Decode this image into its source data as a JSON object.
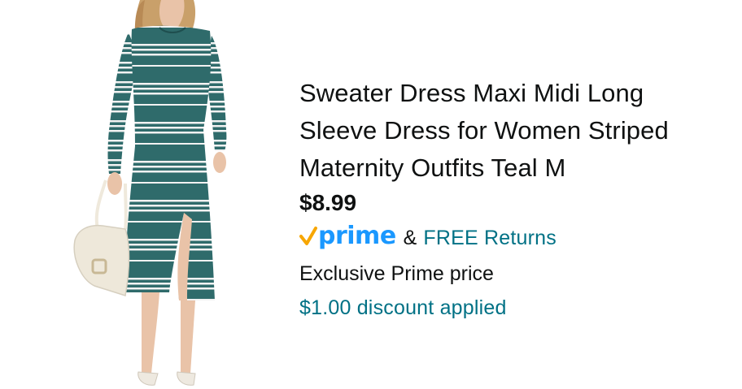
{
  "product": {
    "image_icon": "product-photo-striped-dress",
    "title": "Sweater Dress Maxi Midi Long Sleeve Dress for Women Striped Maternity Outfits Teal M",
    "price": "$8.99",
    "prime": {
      "logo_text": "prime",
      "check_icon": "prime-check-icon",
      "ampersand": "&",
      "returns_label": "FREE Returns"
    },
    "exclusive_label": "Exclusive Prime price",
    "discount_label": "$1.00 discount applied"
  },
  "colors": {
    "prime_blue": "#1a98ff",
    "prime_check": "#f7a600",
    "link_teal": "#007185",
    "dress_teal": "#2f6b6b",
    "text": "#0f1111"
  }
}
